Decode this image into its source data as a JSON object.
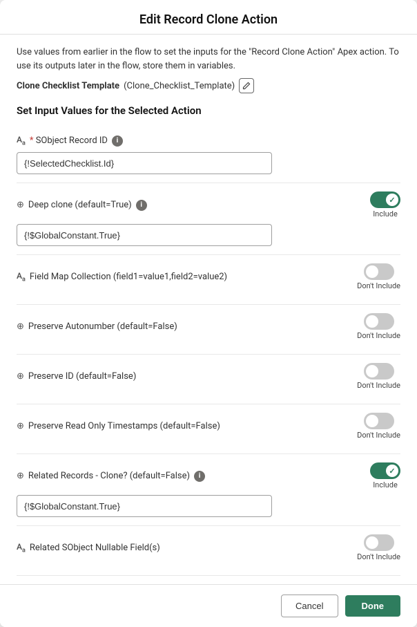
{
  "modal": {
    "title": "Edit Record Clone Action",
    "description": "Use values from earlier in the flow to set the inputs for the \"Record Clone Action\" Apex action. To use its outputs later in the flow, store them in variables.",
    "action_title_bold": "Clone Checklist Template",
    "action_title_parens": "(Clone_Checklist_Template)",
    "section_title": "Set Input Values for the Selected Action",
    "fields": [
      {
        "id": "sobject-record-id",
        "type_icon": "Aa",
        "icon_type": "aa",
        "required": true,
        "label": "* SObject Record ID",
        "has_info": true,
        "has_toggle": false,
        "has_input": true,
        "input_value": "{!SelectedChecklist.Id}",
        "toggle_on": false,
        "toggle_label": ""
      },
      {
        "id": "deep-clone",
        "type_icon": "∞",
        "icon_type": "chain",
        "required": false,
        "label": "Deep clone (default=True)",
        "has_info": true,
        "has_toggle": true,
        "has_input": true,
        "input_value": "{!$GlobalConstant.True}",
        "toggle_on": true,
        "toggle_label": "Include"
      },
      {
        "id": "field-map-collection",
        "type_icon": "Aa",
        "icon_type": "aa",
        "required": false,
        "label": "Field Map Collection (field1=value1,field2=value2)",
        "has_info": false,
        "has_toggle": true,
        "has_input": false,
        "input_value": "",
        "toggle_on": false,
        "toggle_label": "Don't Include"
      },
      {
        "id": "preserve-autonumber",
        "type_icon": "∞",
        "icon_type": "chain",
        "required": false,
        "label": "Preserve Autonumber (default=False)",
        "has_info": false,
        "has_toggle": true,
        "has_input": false,
        "input_value": "",
        "toggle_on": false,
        "toggle_label": "Don't Include"
      },
      {
        "id": "preserve-id",
        "type_icon": "∞",
        "icon_type": "chain",
        "required": false,
        "label": "Preserve ID (default=False)",
        "has_info": false,
        "has_toggle": true,
        "has_input": false,
        "input_value": "",
        "toggle_on": false,
        "toggle_label": "Don't Include"
      },
      {
        "id": "preserve-read-only-timestamps",
        "type_icon": "∞",
        "icon_type": "chain",
        "required": false,
        "label": "Preserve Read Only Timestamps (default=False)",
        "has_info": false,
        "has_toggle": true,
        "has_input": false,
        "input_value": "",
        "toggle_on": false,
        "toggle_label": "Don't Include"
      },
      {
        "id": "related-records-clone",
        "type_icon": "∞",
        "icon_type": "chain",
        "required": false,
        "label": "Related Records - Clone? (default=False)",
        "has_info": true,
        "has_toggle": true,
        "has_input": true,
        "input_value": "{!$GlobalConstant.True}",
        "toggle_on": true,
        "toggle_label": "Include"
      },
      {
        "id": "related-sobject-nullable",
        "type_icon": "Aa",
        "icon_type": "aa",
        "required": false,
        "label": "Related SObject Nullable Field(s)",
        "has_info": false,
        "has_toggle": true,
        "has_input": false,
        "input_value": "",
        "toggle_on": false,
        "toggle_label": "Don't Include"
      }
    ],
    "footer": {
      "cancel_label": "Cancel",
      "done_label": "Done"
    }
  }
}
